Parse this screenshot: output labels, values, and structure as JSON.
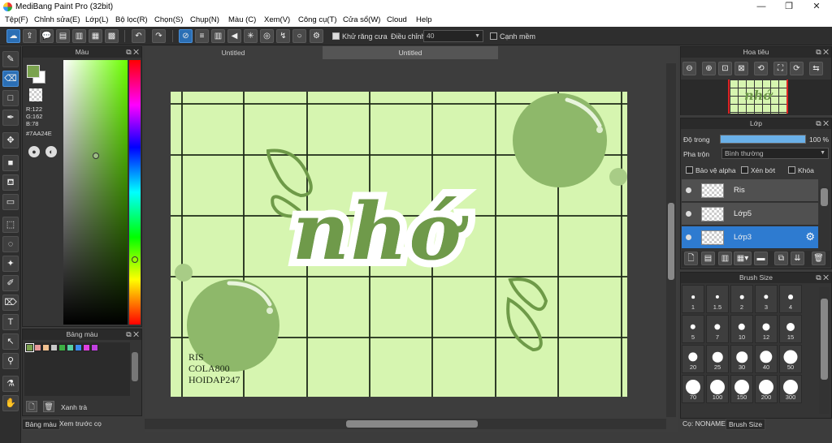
{
  "window": {
    "title": "MediBang Paint Pro (32bit)",
    "min": "—",
    "restore": "❐",
    "close": "✕"
  },
  "menu": [
    "Tệp(F)",
    "Chỉnh sửa(E)",
    "Lớp(L)",
    "Bộ lọc(R)",
    "Chọn(S)",
    "Chụp(N)",
    "Màu (C)",
    "Xem(V)",
    "Công cụ(T)",
    "Cửa sổ(W)",
    "Cloud",
    "Help"
  ],
  "toolbar": {
    "antialias_label": "Khử răng cưa",
    "adjust_label": "Điều chỉnh",
    "adjust_value": "40",
    "soft_edge_label": "Cạnh mềm"
  },
  "color_panel": {
    "title": "Màu",
    "r": "R:122",
    "g": "G:162",
    "b": "B:78",
    "hex": "#7AA24E",
    "primary_color": "#7aa24e"
  },
  "palette_panel": {
    "title": "Bảng màu",
    "add_label": "Xanh trà",
    "colors": [
      "#7aa24e",
      "#e89a9a",
      "#f0c090",
      "#c8c8c8",
      "#3cb043",
      "#58d0a0",
      "#3c8cf0",
      "#e040e0",
      "#c040e0"
    ]
  },
  "bottom_tabs": [
    "Bảng màu",
    "Xem trước cọ"
  ],
  "tabs": [
    "Untitled",
    "Untitled"
  ],
  "artwork": {
    "main_text": "nhớ",
    "credits": [
      "RIS",
      "COLA800",
      "HOIDAP247"
    ]
  },
  "navigator": {
    "title": "Hoa tiêu"
  },
  "layers_panel": {
    "title": "Lớp",
    "opacity_label": "Độ trong",
    "opacity_value": "100 %",
    "opacity_fraction": 1.0,
    "blend_label": "Pha trộn",
    "blend_value": "Bình thường",
    "protect_alpha": "Bảo vệ alpha",
    "clipping": "Xén bớt",
    "lock": "Khóa",
    "layers": [
      {
        "name": "Ris",
        "selected": false
      },
      {
        "name": "Lớp5",
        "selected": false
      },
      {
        "name": "Lớp3",
        "selected": true
      }
    ]
  },
  "brush_size": {
    "title": "Brush Size",
    "sizes": [
      "1",
      "1.5",
      "2",
      "3",
      "4",
      "5",
      "7",
      "10",
      "12",
      "15",
      "20",
      "25",
      "30",
      "40",
      "50",
      "70",
      "100",
      "150",
      "200",
      "300"
    ]
  },
  "status": {
    "brush_label": "Cọ: NONAME",
    "brush_tab": "Brush Size"
  }
}
